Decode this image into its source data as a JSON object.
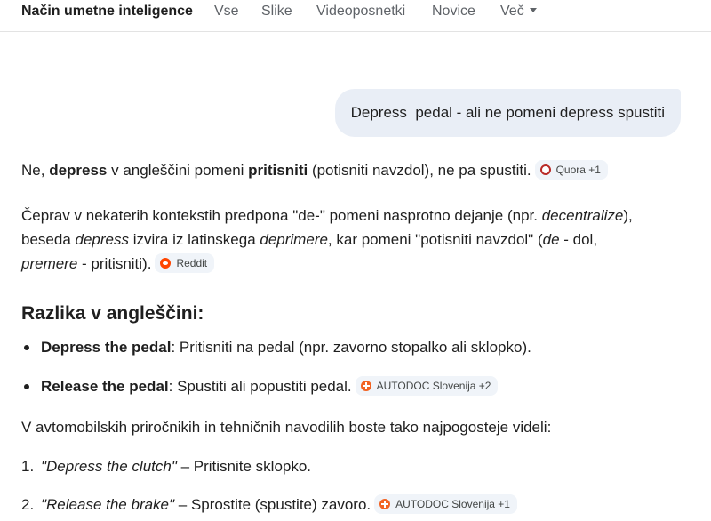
{
  "nav": {
    "tabs": [
      {
        "label": "Način umetne inteligence"
      },
      {
        "label": "Vse"
      },
      {
        "label": "Slike"
      },
      {
        "label": "Videoposnetki"
      },
      {
        "label": "Novice"
      },
      {
        "label": "Več"
      }
    ]
  },
  "query": "Depress  pedal - ali ne pomeni depress spustiti",
  "answer": {
    "p1": {
      "t1": "Ne, ",
      "b1": "depress",
      "t2": " v angleščini pomeni ",
      "b2": "pritisniti",
      "t3": " (potisniti navzdol), ne pa spustiti.",
      "chip": "Quora +1"
    },
    "p2": {
      "t1": "Čeprav v nekaterih kontekstih predpona \"de-\" pomeni nasprotno dejanje (npr. ",
      "i1": "decentralize",
      "t2": "), beseda ",
      "i2": "depress",
      "t3": " izvira iz latinskega ",
      "i3": "deprimere",
      "t4": ", kar pomeni \"potisniti navzdol\" (",
      "i4": "de",
      "t5": " - dol, ",
      "i5": "premere",
      "t6": " - pritisniti).",
      "chip": "Reddit"
    },
    "heading": "Razlika v angleščini:",
    "bullets": [
      {
        "bold": "Depress the pedal",
        "text": ": Pritisniti na pedal (npr. zavorno stopalko ali sklopko).",
        "chip": ""
      },
      {
        "bold": "Release the pedal",
        "text": ": Spustiti ali popustiti pedal.",
        "chip": "AUTODOC Slovenija +2"
      }
    ],
    "p3": "V avtomobilskih priročnikih in tehničnih navodilih boste tako najpogosteje videli:",
    "numbered": [
      {
        "num": "1.",
        "italic": "\"Depress the clutch\"",
        "text": " – Pritisnite sklopko.",
        "chip": ""
      },
      {
        "num": "2.",
        "italic": "\"Release the brake\"",
        "text": " – Sprostite (spustite) zavoro.",
        "chip": "AUTODOC Slovenija +1"
      }
    ]
  },
  "icons": {
    "quora": "quora-icon",
    "reddit": "reddit-icon",
    "autodoc": "autodoc-icon"
  },
  "colors": {
    "bubble": "#e9eef6",
    "chip": "#f0f4f9",
    "quora": "#b92b27",
    "reddit": "#ff4500",
    "autodoc": "#f26322"
  }
}
